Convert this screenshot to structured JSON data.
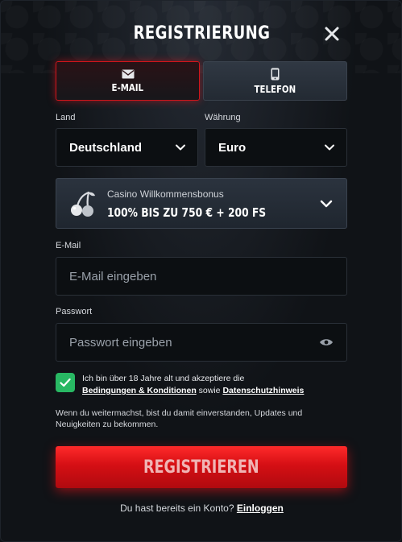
{
  "header": {
    "title": "REGISTRIERUNG"
  },
  "tabs": [
    {
      "label": "E-MAIL",
      "active": true,
      "icon": "envelope-icon"
    },
    {
      "label": "TELEFON",
      "active": false,
      "icon": "phone-icon"
    }
  ],
  "country": {
    "label": "Land",
    "value": "Deutschland"
  },
  "currency": {
    "label": "Währung",
    "value": "Euro"
  },
  "bonus": {
    "icon": "cherries-icon",
    "title": "Casino Willkommensbonus",
    "offer": "100% BIS ZU 750 € + 200 FS"
  },
  "email": {
    "label": "E-Mail",
    "placeholder": "E-Mail eingeben"
  },
  "password": {
    "label": "Passwort",
    "placeholder": "Passwort eingeben"
  },
  "terms": {
    "checked": true,
    "text_before": "Ich bin über 18 Jahre alt und akzeptiere die",
    "terms_link": "Bedingungen & Konditionen",
    "conjunction": "sowie",
    "privacy_link": "Datenschutzhinweis"
  },
  "notice": "Wenn du weitermachst, bist du damit einverstanden, Updates und Neuigkeiten zu bekommen.",
  "register_button": "REGISTRIEREN",
  "login": {
    "question": "Du hast bereits ein Konto?",
    "link": "Einloggen"
  },
  "colors": {
    "accent": "#d50f14",
    "checkbox": "#28b863",
    "background": "#101317"
  }
}
